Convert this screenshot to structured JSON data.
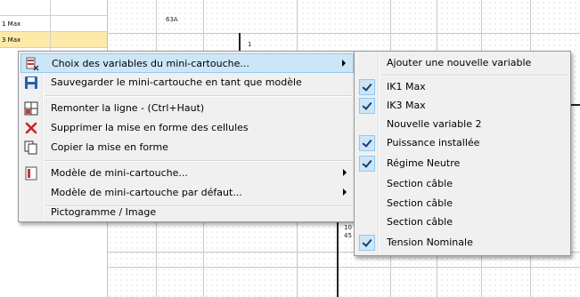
{
  "sheet": {
    "row_labels": [
      "1 Max",
      "3 Max"
    ],
    "cell_texts": {
      "c63a": "63A",
      "c1": "1",
      "c10": "10",
      "c45": "45"
    }
  },
  "context_menu": {
    "items": [
      {
        "label": "Choix des variables du mini-cartouche...",
        "icon": "variables-icon"
      },
      {
        "label": "Sauvegarder le mini-cartouche en tant que modèle",
        "icon": "save-icon"
      },
      {
        "label": "Remonter la ligne - (Ctrl+Haut)",
        "icon": "move-row-up-icon"
      },
      {
        "label": "Supprimer la mise en forme des cellules",
        "icon": "delete-icon"
      },
      {
        "label": "Copier la mise en forme",
        "icon": "copy-format-icon"
      },
      {
        "label": "Modèle de mini-cartouche...",
        "icon": "template-icon"
      },
      {
        "label": "Modèle de mini-cartouche par défaut...",
        "icon": ""
      },
      {
        "label": "Pictogramme / Image",
        "icon": ""
      }
    ]
  },
  "submenu": {
    "items": [
      {
        "label": "Ajouter une nouvelle variable",
        "checked": false
      },
      {
        "label": "IK1 Max",
        "checked": true
      },
      {
        "label": "IK3 Max",
        "checked": true
      },
      {
        "label": "Nouvelle variable 2",
        "checked": false
      },
      {
        "label": "Puissance installée",
        "checked": true
      },
      {
        "label": "Régime Neutre",
        "checked": true
      },
      {
        "label": "Section câble",
        "checked": false
      },
      {
        "label": "Section câble",
        "checked": false
      },
      {
        "label": "Section câble",
        "checked": false
      },
      {
        "label": "Tension Nominale",
        "checked": true
      }
    ]
  },
  "colors": {
    "highlight": "#cde6f7",
    "highlight_border": "#90c8f6",
    "row_selected": "#fde9a8",
    "menu_bg": "#f0f0f0"
  }
}
